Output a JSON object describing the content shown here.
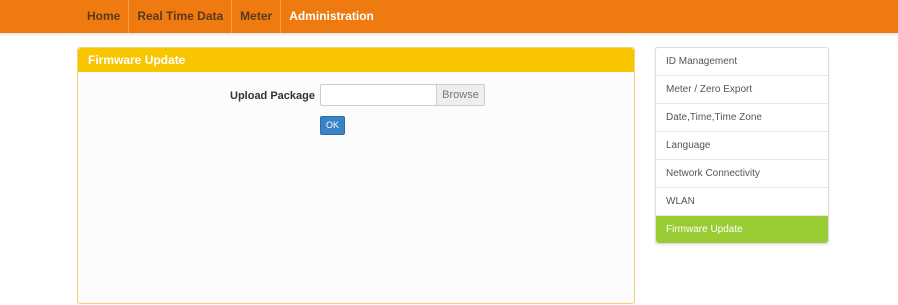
{
  "nav": {
    "items": [
      {
        "label": "Home"
      },
      {
        "label": "Real Time Data"
      },
      {
        "label": "Meter"
      },
      {
        "label": "Administration"
      }
    ],
    "active": "Administration"
  },
  "panel": {
    "title": "Firmware Update",
    "upload_label": "Upload Package",
    "file_value": "",
    "browse_label": "Browse",
    "ok_label": "OK"
  },
  "sidebar": {
    "items": [
      {
        "label": "ID Management"
      },
      {
        "label": "Meter / Zero Export"
      },
      {
        "label": "Date,Time,Time Zone"
      },
      {
        "label": "Language"
      },
      {
        "label": "Network Connectivity"
      },
      {
        "label": "WLAN"
      },
      {
        "label": "Firmware Update"
      }
    ],
    "active": "Firmware Update"
  },
  "colors": {
    "topbar": "#ee7a10",
    "panel_header": "#f9c500",
    "active_sidebar": "#99cc33",
    "ok_button": "#3a83c6"
  }
}
